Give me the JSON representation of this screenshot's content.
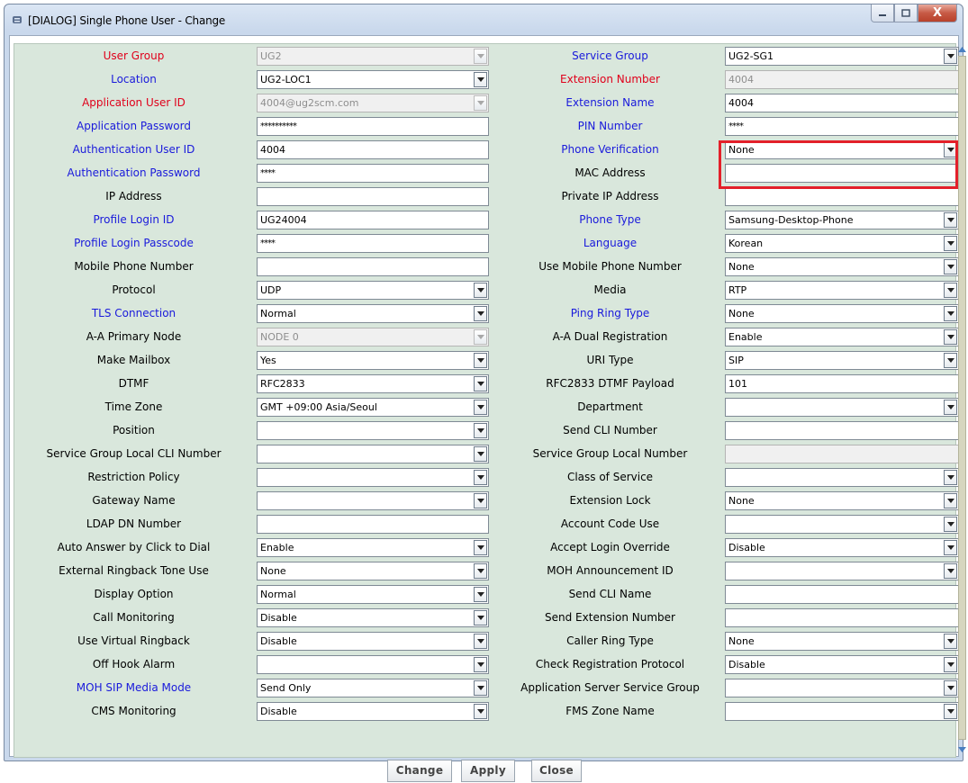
{
  "window": {
    "title": "[DIALOG] Single Phone User - Change",
    "minimize_icon": "minimize-icon",
    "maximize_icon": "maximize-icon",
    "close_label": "X"
  },
  "left_fields": [
    {
      "label": "User Group",
      "color": "red",
      "value": "UG2",
      "type": "select",
      "disabled": true
    },
    {
      "label": "Location",
      "color": "blue",
      "value": "UG2-LOC1",
      "type": "select"
    },
    {
      "label": "Application User ID",
      "color": "red",
      "value": "4004@ug2scm.com",
      "type": "select",
      "disabled": true
    },
    {
      "label": "Application Password",
      "color": "blue",
      "value": "**********",
      "type": "password"
    },
    {
      "label": "Authentication User ID",
      "color": "blue",
      "value": "4004",
      "type": "text"
    },
    {
      "label": "Authentication Password",
      "color": "blue",
      "value": "****",
      "type": "password"
    },
    {
      "label": "IP Address",
      "color": "black",
      "value": "",
      "type": "text"
    },
    {
      "label": "Profile Login ID",
      "color": "blue",
      "value": "UG24004",
      "type": "text"
    },
    {
      "label": "Profile Login Passcode",
      "color": "blue",
      "value": "****",
      "type": "password"
    },
    {
      "label": "Mobile Phone Number",
      "color": "black",
      "value": "",
      "type": "text"
    },
    {
      "label": "Protocol",
      "color": "black",
      "value": "UDP",
      "type": "select"
    },
    {
      "label": "TLS Connection",
      "color": "blue",
      "value": "Normal",
      "type": "select"
    },
    {
      "label": "A-A Primary Node",
      "color": "black",
      "value": "NODE 0",
      "type": "select",
      "disabled": true
    },
    {
      "label": "Make Mailbox",
      "color": "black",
      "value": "Yes",
      "type": "select"
    },
    {
      "label": "DTMF",
      "color": "black",
      "value": "RFC2833",
      "type": "select"
    },
    {
      "label": "Time Zone",
      "color": "black",
      "value": "GMT +09:00 Asia/Seoul",
      "type": "select"
    },
    {
      "label": "Position",
      "color": "black",
      "value": "",
      "type": "select"
    },
    {
      "label": "Service Group Local CLI Number",
      "color": "black",
      "value": "",
      "type": "select"
    },
    {
      "label": "Restriction Policy",
      "color": "black",
      "value": "",
      "type": "select"
    },
    {
      "label": "Gateway Name",
      "color": "black",
      "value": "",
      "type": "select"
    },
    {
      "label": "LDAP DN Number",
      "color": "black",
      "value": "",
      "type": "text"
    },
    {
      "label": "Auto Answer by Click to Dial",
      "color": "black",
      "value": "Enable",
      "type": "select"
    },
    {
      "label": "External Ringback Tone Use",
      "color": "black",
      "value": "None",
      "type": "select"
    },
    {
      "label": "Display Option",
      "color": "black",
      "value": "Normal",
      "type": "select"
    },
    {
      "label": "Call Monitoring",
      "color": "black",
      "value": "Disable",
      "type": "select"
    },
    {
      "label": "Use Virtual Ringback",
      "color": "black",
      "value": "Disable",
      "type": "select"
    },
    {
      "label": "Off Hook Alarm",
      "color": "black",
      "value": "",
      "type": "select"
    },
    {
      "label": "MOH SIP Media Mode",
      "color": "blue",
      "value": "Send Only",
      "type": "select"
    },
    {
      "label": "CMS Monitoring",
      "color": "black",
      "value": "Disable",
      "type": "select"
    }
  ],
  "right_fields": [
    {
      "label": "Service Group",
      "color": "blue",
      "value": "UG2-SG1",
      "type": "select"
    },
    {
      "label": "Extension Number",
      "color": "red",
      "value": "4004",
      "type": "text",
      "disabled": true
    },
    {
      "label": "Extension Name",
      "color": "blue",
      "value": "4004",
      "type": "text"
    },
    {
      "label": "PIN Number",
      "color": "blue",
      "value": "****",
      "type": "password"
    },
    {
      "label": "Phone Verification",
      "color": "blue",
      "value": "None",
      "type": "select"
    },
    {
      "label": "MAC Address",
      "color": "black",
      "value": "",
      "type": "text"
    },
    {
      "label": "Private IP Address",
      "color": "black",
      "value": "",
      "type": "text"
    },
    {
      "label": "Phone Type",
      "color": "blue",
      "value": "Samsung-Desktop-Phone",
      "type": "select"
    },
    {
      "label": "Language",
      "color": "blue",
      "value": "Korean",
      "type": "select"
    },
    {
      "label": "Use Mobile Phone Number",
      "color": "black",
      "value": "None",
      "type": "select"
    },
    {
      "label": "Media",
      "color": "black",
      "value": "RTP",
      "type": "select"
    },
    {
      "label": "Ping Ring Type",
      "color": "blue",
      "value": "None",
      "type": "select"
    },
    {
      "label": "A-A Dual Registration",
      "color": "black",
      "value": "Enable",
      "type": "select"
    },
    {
      "label": "URI Type",
      "color": "black",
      "value": "SIP",
      "type": "select"
    },
    {
      "label": "RFC2833 DTMF Payload",
      "color": "black",
      "value": "101",
      "type": "text"
    },
    {
      "label": "Department",
      "color": "black",
      "value": "",
      "type": "select"
    },
    {
      "label": "Send CLI Number",
      "color": "black",
      "value": "",
      "type": "text"
    },
    {
      "label": "Service Group Local Number",
      "color": "black",
      "value": "",
      "type": "text",
      "disabled": true
    },
    {
      "label": "Class of Service",
      "color": "black",
      "value": "",
      "type": "select"
    },
    {
      "label": "Extension Lock",
      "color": "black",
      "value": "None",
      "type": "select"
    },
    {
      "label": "Account Code Use",
      "color": "black",
      "value": "",
      "type": "select"
    },
    {
      "label": "Accept Login Override",
      "color": "black",
      "value": "Disable",
      "type": "select"
    },
    {
      "label": "MOH Announcement ID",
      "color": "black",
      "value": "",
      "type": "select"
    },
    {
      "label": "Send CLI Name",
      "color": "black",
      "value": "",
      "type": "text"
    },
    {
      "label": "Send Extension Number",
      "color": "black",
      "value": "",
      "type": "text"
    },
    {
      "label": "Caller Ring Type",
      "color": "black",
      "value": "None",
      "type": "select"
    },
    {
      "label": "Check Registration Protocol",
      "color": "black",
      "value": "Disable",
      "type": "select"
    },
    {
      "label": "Application Server Service Group",
      "color": "black",
      "value": "",
      "type": "select"
    },
    {
      "label": "FMS Zone Name",
      "color": "black",
      "value": "",
      "type": "select"
    }
  ],
  "buttons": {
    "change": "Change",
    "apply": "Apply",
    "close": "Close"
  },
  "colors": {
    "label_red": "#e0001b",
    "label_blue": "#1a1adb",
    "panel_bg": "#d9e7dc",
    "highlight": "#e3202a"
  }
}
